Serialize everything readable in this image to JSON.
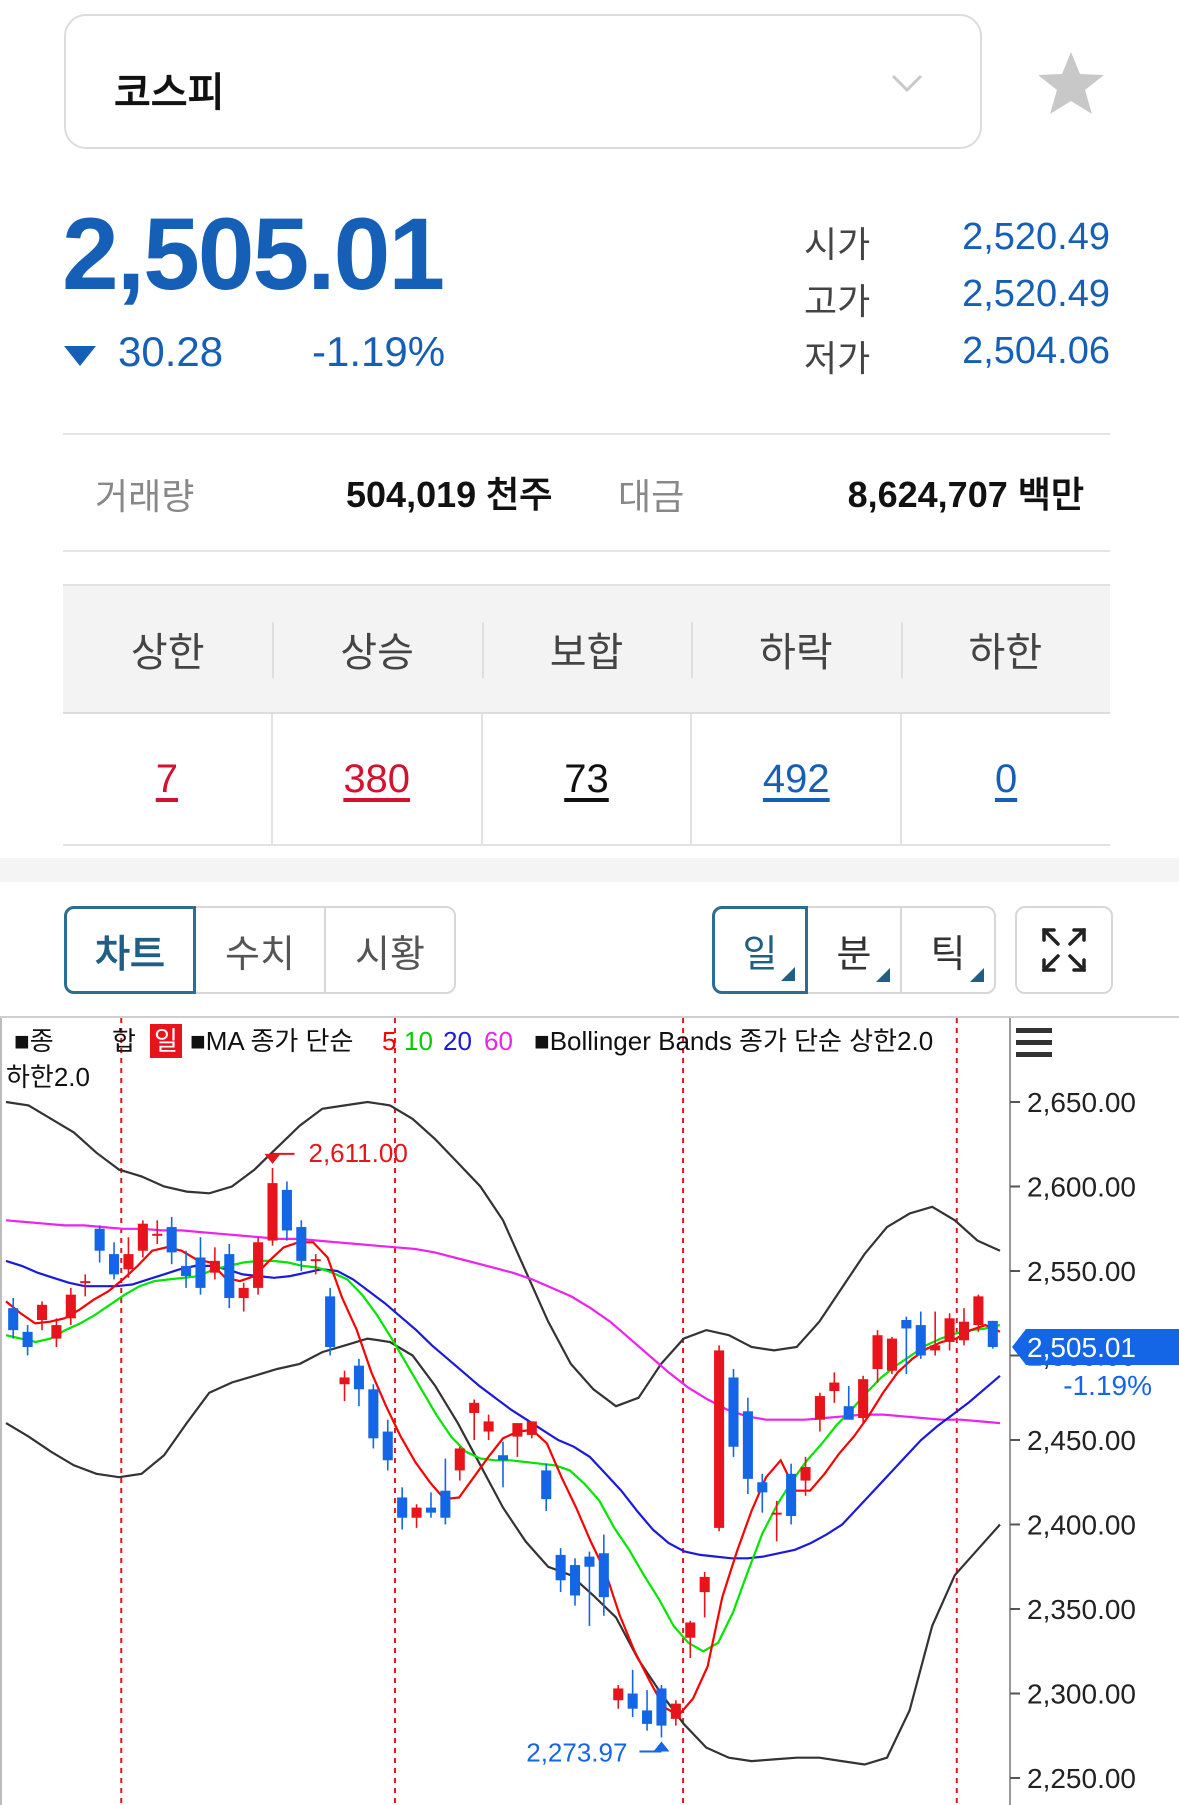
{
  "selector": {
    "name": "코스피",
    "chevron_icon": "chevron-down-icon",
    "favorite_icon": "star-icon"
  },
  "quote": {
    "price": "2,505.01",
    "change": "30.28",
    "change_pct": "-1.19%",
    "direction": "down",
    "color": "#1560b6"
  },
  "ohlc": [
    {
      "label": "시가",
      "value": "2,520.49"
    },
    {
      "label": "고가",
      "value": "2,520.49"
    },
    {
      "label": "저가",
      "value": "2,504.06"
    }
  ],
  "volume": {
    "label": "거래량",
    "value": "504,019 천주"
  },
  "amount": {
    "label": "대금",
    "value": "8,624,707 백만"
  },
  "breadth": {
    "headers": [
      "상한",
      "상승",
      "보합",
      "하락",
      "하한"
    ],
    "values": [
      "7",
      "380",
      "73",
      "492",
      "0"
    ],
    "colors": [
      "#d2122e",
      "#d2122e",
      "#111111",
      "#1560b6",
      "#1560b6"
    ]
  },
  "tabs": [
    "차트",
    "수치",
    "시황"
  ],
  "active_tab": "차트",
  "period_tabs": [
    "일",
    "분",
    "틱"
  ],
  "active_period": "일",
  "chart": {
    "legend": {
      "main_prefix": "■종",
      "main_suffix": "합",
      "period_badge": "일",
      "ma_label": "■MA 종가 단순",
      "ma_periods": [
        "5",
        "10",
        "20",
        "60"
      ],
      "bb_label": "■Bollinger Bands 종가 단순 상한2.0",
      "bb_lower": "하한2.0"
    },
    "menu_icon": "hamburger-menu-icon",
    "current_price_label": "2,505.01",
    "current_change_label": "-1.19%",
    "high_marker": "2,611.00",
    "low_marker": "2,273.97"
  },
  "chart_data": {
    "type": "candlestick",
    "y_ticks": [
      "2,650.00",
      "2,600.00",
      "2,550.00",
      "2,500.00",
      "2,450.00",
      "2,400.00",
      "2,350.00",
      "2,300.00",
      "2,250.00"
    ],
    "ylim": [
      2240,
      2690
    ],
    "colors": {
      "up": "#e8141c",
      "down": "#1566e6",
      "ma5": "#ff0000",
      "ma10": "#00e600",
      "ma20": "#1a1adb",
      "ma60": "#ee22ee",
      "bb": "#333333"
    },
    "candles": [
      {
        "o": 2528,
        "h": 2534,
        "l": 2510,
        "c": 2515
      },
      {
        "o": 2514,
        "h": 2518,
        "l": 2500,
        "c": 2505
      },
      {
        "o": 2521,
        "h": 2532,
        "l": 2515,
        "c": 2530
      },
      {
        "o": 2510,
        "h": 2522,
        "l": 2505,
        "c": 2518
      },
      {
        "o": 2522,
        "h": 2540,
        "l": 2518,
        "c": 2536
      },
      {
        "o": 2543,
        "h": 2548,
        "l": 2535,
        "c": 2544
      },
      {
        "o": 2575,
        "h": 2577,
        "l": 2555,
        "c": 2562
      },
      {
        "o": 2560,
        "h": 2567,
        "l": 2545,
        "c": 2548
      },
      {
        "o": 2551,
        "h": 2570,
        "l": 2546,
        "c": 2560
      },
      {
        "o": 2562,
        "h": 2580,
        "l": 2558,
        "c": 2578
      },
      {
        "o": 2572,
        "h": 2580,
        "l": 2566,
        "c": 2572
      },
      {
        "o": 2576,
        "h": 2582,
        "l": 2554,
        "c": 2561
      },
      {
        "o": 2553,
        "h": 2562,
        "l": 2540,
        "c": 2547
      },
      {
        "o": 2558,
        "h": 2570,
        "l": 2536,
        "c": 2540
      },
      {
        "o": 2549,
        "h": 2564,
        "l": 2545,
        "c": 2556
      },
      {
        "o": 2560,
        "h": 2566,
        "l": 2528,
        "c": 2534
      },
      {
        "o": 2534,
        "h": 2543,
        "l": 2526,
        "c": 2540
      },
      {
        "o": 2540,
        "h": 2570,
        "l": 2536,
        "c": 2567
      },
      {
        "o": 2568,
        "h": 2611,
        "l": 2565,
        "c": 2602
      },
      {
        "o": 2598,
        "h": 2603,
        "l": 2568,
        "c": 2574
      },
      {
        "o": 2576,
        "h": 2580,
        "l": 2550,
        "c": 2556
      },
      {
        "o": 2556,
        "h": 2560,
        "l": 2548,
        "c": 2557
      },
      {
        "o": 2535,
        "h": 2540,
        "l": 2500,
        "c": 2505
      },
      {
        "o": 2483,
        "h": 2491,
        "l": 2473,
        "c": 2487
      },
      {
        "o": 2494,
        "h": 2498,
        "l": 2470,
        "c": 2480
      },
      {
        "o": 2480,
        "h": 2483,
        "l": 2445,
        "c": 2451
      },
      {
        "o": 2455,
        "h": 2462,
        "l": 2432,
        "c": 2438
      },
      {
        "o": 2416,
        "h": 2422,
        "l": 2397,
        "c": 2404
      },
      {
        "o": 2404,
        "h": 2412,
        "l": 2398,
        "c": 2410
      },
      {
        "o": 2410,
        "h": 2419,
        "l": 2404,
        "c": 2407
      },
      {
        "o": 2420,
        "h": 2439,
        "l": 2400,
        "c": 2404
      },
      {
        "o": 2432,
        "h": 2446,
        "l": 2426,
        "c": 2445
      },
      {
        "o": 2466,
        "h": 2474,
        "l": 2450,
        "c": 2472
      },
      {
        "o": 2455,
        "h": 2465,
        "l": 2450,
        "c": 2461
      },
      {
        "o": 2441,
        "h": 2449,
        "l": 2422,
        "c": 2438
      },
      {
        "o": 2452,
        "h": 2459,
        "l": 2440,
        "c": 2460
      },
      {
        "o": 2453,
        "h": 2459,
        "l": 2451,
        "c": 2461
      },
      {
        "o": 2432,
        "h": 2436,
        "l": 2408,
        "c": 2415
      },
      {
        "o": 2382,
        "h": 2386,
        "l": 2360,
        "c": 2367
      },
      {
        "o": 2376,
        "h": 2380,
        "l": 2352,
        "c": 2358
      },
      {
        "o": 2381,
        "h": 2384,
        "l": 2340,
        "c": 2375
      },
      {
        "o": 2383,
        "h": 2394,
        "l": 2346,
        "c": 2357
      },
      {
        "o": 2296,
        "h": 2305,
        "l": 2291,
        "c": 2303
      },
      {
        "o": 2300,
        "h": 2314,
        "l": 2286,
        "c": 2291
      },
      {
        "o": 2290,
        "h": 2302,
        "l": 2278,
        "c": 2282
      },
      {
        "o": 2303,
        "h": 2305,
        "l": 2273.97,
        "c": 2281
      },
      {
        "o": 2285,
        "h": 2296,
        "l": 2281,
        "c": 2294
      },
      {
        "o": 2333,
        "h": 2343,
        "l": 2321,
        "c": 2342
      },
      {
        "o": 2360,
        "h": 2372,
        "l": 2345,
        "c": 2369
      },
      {
        "o": 2398,
        "h": 2506,
        "l": 2396,
        "c": 2503
      },
      {
        "o": 2487,
        "h": 2492,
        "l": 2440,
        "c": 2446
      },
      {
        "o": 2467,
        "h": 2475,
        "l": 2418,
        "c": 2427
      },
      {
        "o": 2425,
        "h": 2430,
        "l": 2407,
        "c": 2419
      },
      {
        "o": 2407,
        "h": 2414,
        "l": 2390,
        "c": 2407
      },
      {
        "o": 2430,
        "h": 2436,
        "l": 2400,
        "c": 2405
      },
      {
        "o": 2426,
        "h": 2440,
        "l": 2417,
        "c": 2434
      },
      {
        "o": 2462,
        "h": 2478,
        "l": 2455,
        "c": 2476
      },
      {
        "o": 2479,
        "h": 2490,
        "l": 2472,
        "c": 2484
      },
      {
        "o": 2470,
        "h": 2482,
        "l": 2466,
        "c": 2462
      },
      {
        "o": 2463,
        "h": 2488,
        "l": 2460,
        "c": 2486
      },
      {
        "o": 2492,
        "h": 2515,
        "l": 2484,
        "c": 2512
      },
      {
        "o": 2491,
        "h": 2511,
        "l": 2489,
        "c": 2510
      },
      {
        "o": 2521,
        "h": 2523,
        "l": 2489,
        "c": 2516
      },
      {
        "o": 2518,
        "h": 2526,
        "l": 2498,
        "c": 2500
      },
      {
        "o": 2503,
        "h": 2526,
        "l": 2500,
        "c": 2506
      },
      {
        "o": 2508,
        "h": 2525,
        "l": 2503,
        "c": 2522
      },
      {
        "o": 2509,
        "h": 2528,
        "l": 2506,
        "c": 2520
      },
      {
        "o": 2518,
        "h": 2536,
        "l": 2514,
        "c": 2535
      },
      {
        "o": 2520.49,
        "h": 2520.49,
        "l": 2504.06,
        "c": 2505.01
      }
    ],
    "ma5": [
      2532,
      2525,
      2519,
      2520,
      2522,
      2527,
      2533,
      2538,
      2545,
      2553,
      2562,
      2564,
      2562,
      2557,
      2555,
      2546,
      2544,
      2547,
      2556,
      2564,
      2567,
      2567,
      2558,
      2534,
      2515,
      2490,
      2470,
      2452,
      2437,
      2425,
      2415,
      2416,
      2428,
      2440,
      2451,
      2455,
      2456,
      2448,
      2428,
      2410,
      2390,
      2372,
      2346,
      2325,
      2308,
      2292,
      2287,
      2297,
      2316,
      2357,
      2384,
      2408,
      2428,
      2438,
      2420,
      2420,
      2430,
      2442,
      2452,
      2464,
      2478,
      2490,
      2498,
      2504,
      2508,
      2510,
      2515,
      2518,
      2514
    ],
    "ma10": [
      2512,
      2510,
      2508,
      2510,
      2515,
      2519,
      2524,
      2530,
      2536,
      2541,
      2544,
      2545,
      2546,
      2547,
      2551,
      2553,
      2555,
      2556,
      2556,
      2555,
      2553,
      2552,
      2549,
      2545,
      2536,
      2524,
      2510,
      2495,
      2480,
      2465,
      2452,
      2443,
      2439,
      2438,
      2438,
      2437,
      2436,
      2435,
      2432,
      2424,
      2414,
      2398,
      2385,
      2370,
      2356,
      2340,
      2330,
      2325,
      2330,
      2348,
      2372,
      2395,
      2412,
      2426,
      2438,
      2448,
      2459,
      2468,
      2478,
      2487,
      2494,
      2500,
      2506,
      2510,
      2513,
      2515,
      2516,
      2518
    ],
    "ma20": [
      2556,
      2553,
      2549,
      2546,
      2543,
      2541,
      2541,
      2541,
      2542,
      2545,
      2548,
      2551,
      2553,
      2553,
      2551,
      2548,
      2547,
      2546,
      2547,
      2549,
      2551,
      2550,
      2545,
      2538,
      2531,
      2523,
      2515,
      2506,
      2498,
      2490,
      2482,
      2475,
      2468,
      2462,
      2456,
      2450,
      2446,
      2440,
      2430,
      2420,
      2408,
      2397,
      2389,
      2384,
      2382,
      2381,
      2380,
      2380,
      2381,
      2383,
      2385,
      2389,
      2394,
      2400,
      2410,
      2420,
      2430,
      2440,
      2450,
      2458,
      2465,
      2472,
      2480,
      2488
    ],
    "ma60": [
      2580,
      2579,
      2578,
      2577,
      2577,
      2576,
      2575,
      2575,
      2574,
      2574,
      2573,
      2572,
      2571,
      2570,
      2569,
      2569,
      2568,
      2567,
      2566,
      2565,
      2564,
      2563,
      2561,
      2558,
      2555,
      2552,
      2549,
      2545,
      2540,
      2535,
      2528,
      2520,
      2510,
      2500,
      2490,
      2481,
      2474,
      2468,
      2464,
      2462,
      2462,
      2462,
      2463,
      2464,
      2465,
      2465,
      2464,
      2463,
      2462,
      2462,
      2461,
      2460
    ],
    "bb_upper": [
      2650,
      2648,
      2640,
      2632,
      2620,
      2610,
      2606,
      2600,
      2597,
      2596,
      2600,
      2610,
      2623,
      2636,
      2646,
      2648,
      2650,
      2648,
      2640,
      2628,
      2614,
      2600,
      2580,
      2550,
      2520,
      2495,
      2480,
      2470,
      2475,
      2495,
      2510,
      2515,
      2512,
      2505,
      2503,
      2505,
      2520,
      2540,
      2560,
      2576,
      2584,
      2588,
      2580,
      2568,
      2562
    ],
    "bb_lower": [
      2460,
      2452,
      2443,
      2435,
      2430,
      2428,
      2430,
      2441,
      2460,
      2478,
      2484,
      2488,
      2492,
      2495,
      2502,
      2506,
      2510,
      2508,
      2500,
      2482,
      2460,
      2435,
      2410,
      2390,
      2375,
      2370,
      2358,
      2345,
      2320,
      2300,
      2282,
      2268,
      2262,
      2260,
      2261,
      2262,
      2262,
      2260,
      2258,
      2262,
      2290,
      2340,
      2370,
      2385,
      2400
    ]
  }
}
